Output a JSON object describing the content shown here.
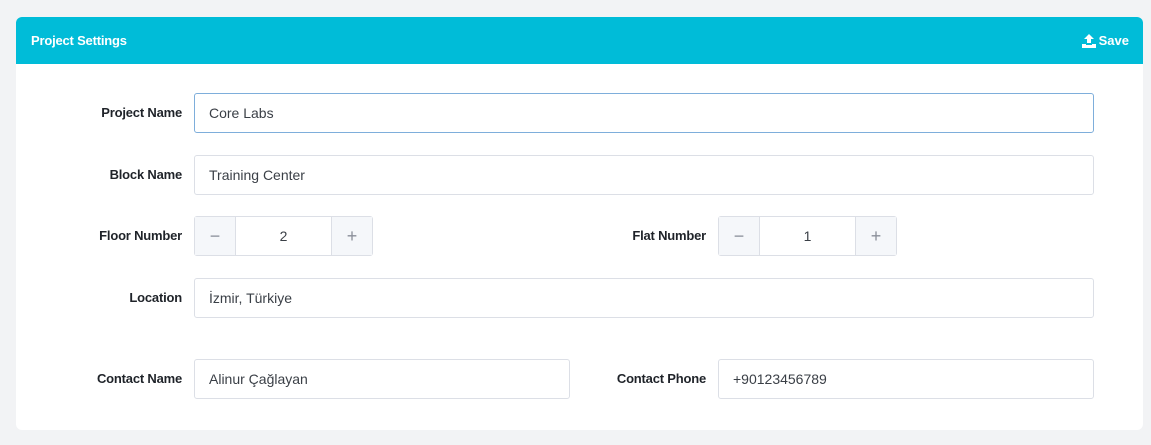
{
  "header": {
    "title": "Project Settings",
    "save_label": "Save",
    "save_icon": "upload-icon",
    "color": "#00bcd8"
  },
  "form": {
    "project_name": {
      "label": "Project Name",
      "value": "Core Labs"
    },
    "block_name": {
      "label": "Block Name",
      "value": "Training Center"
    },
    "floor_number": {
      "label": "Floor Number",
      "value": "2",
      "minus": "−",
      "plus": "+"
    },
    "flat_number": {
      "label": "Flat Number",
      "value": "1",
      "minus": "−",
      "plus": "+"
    },
    "location": {
      "label": "Location",
      "value": "İzmir, Türkiye"
    },
    "contact_name": {
      "label": "Contact Name",
      "value": "Alinur Çağlayan"
    },
    "contact_phone": {
      "label": "Contact Phone",
      "value": "+90123456789"
    }
  }
}
